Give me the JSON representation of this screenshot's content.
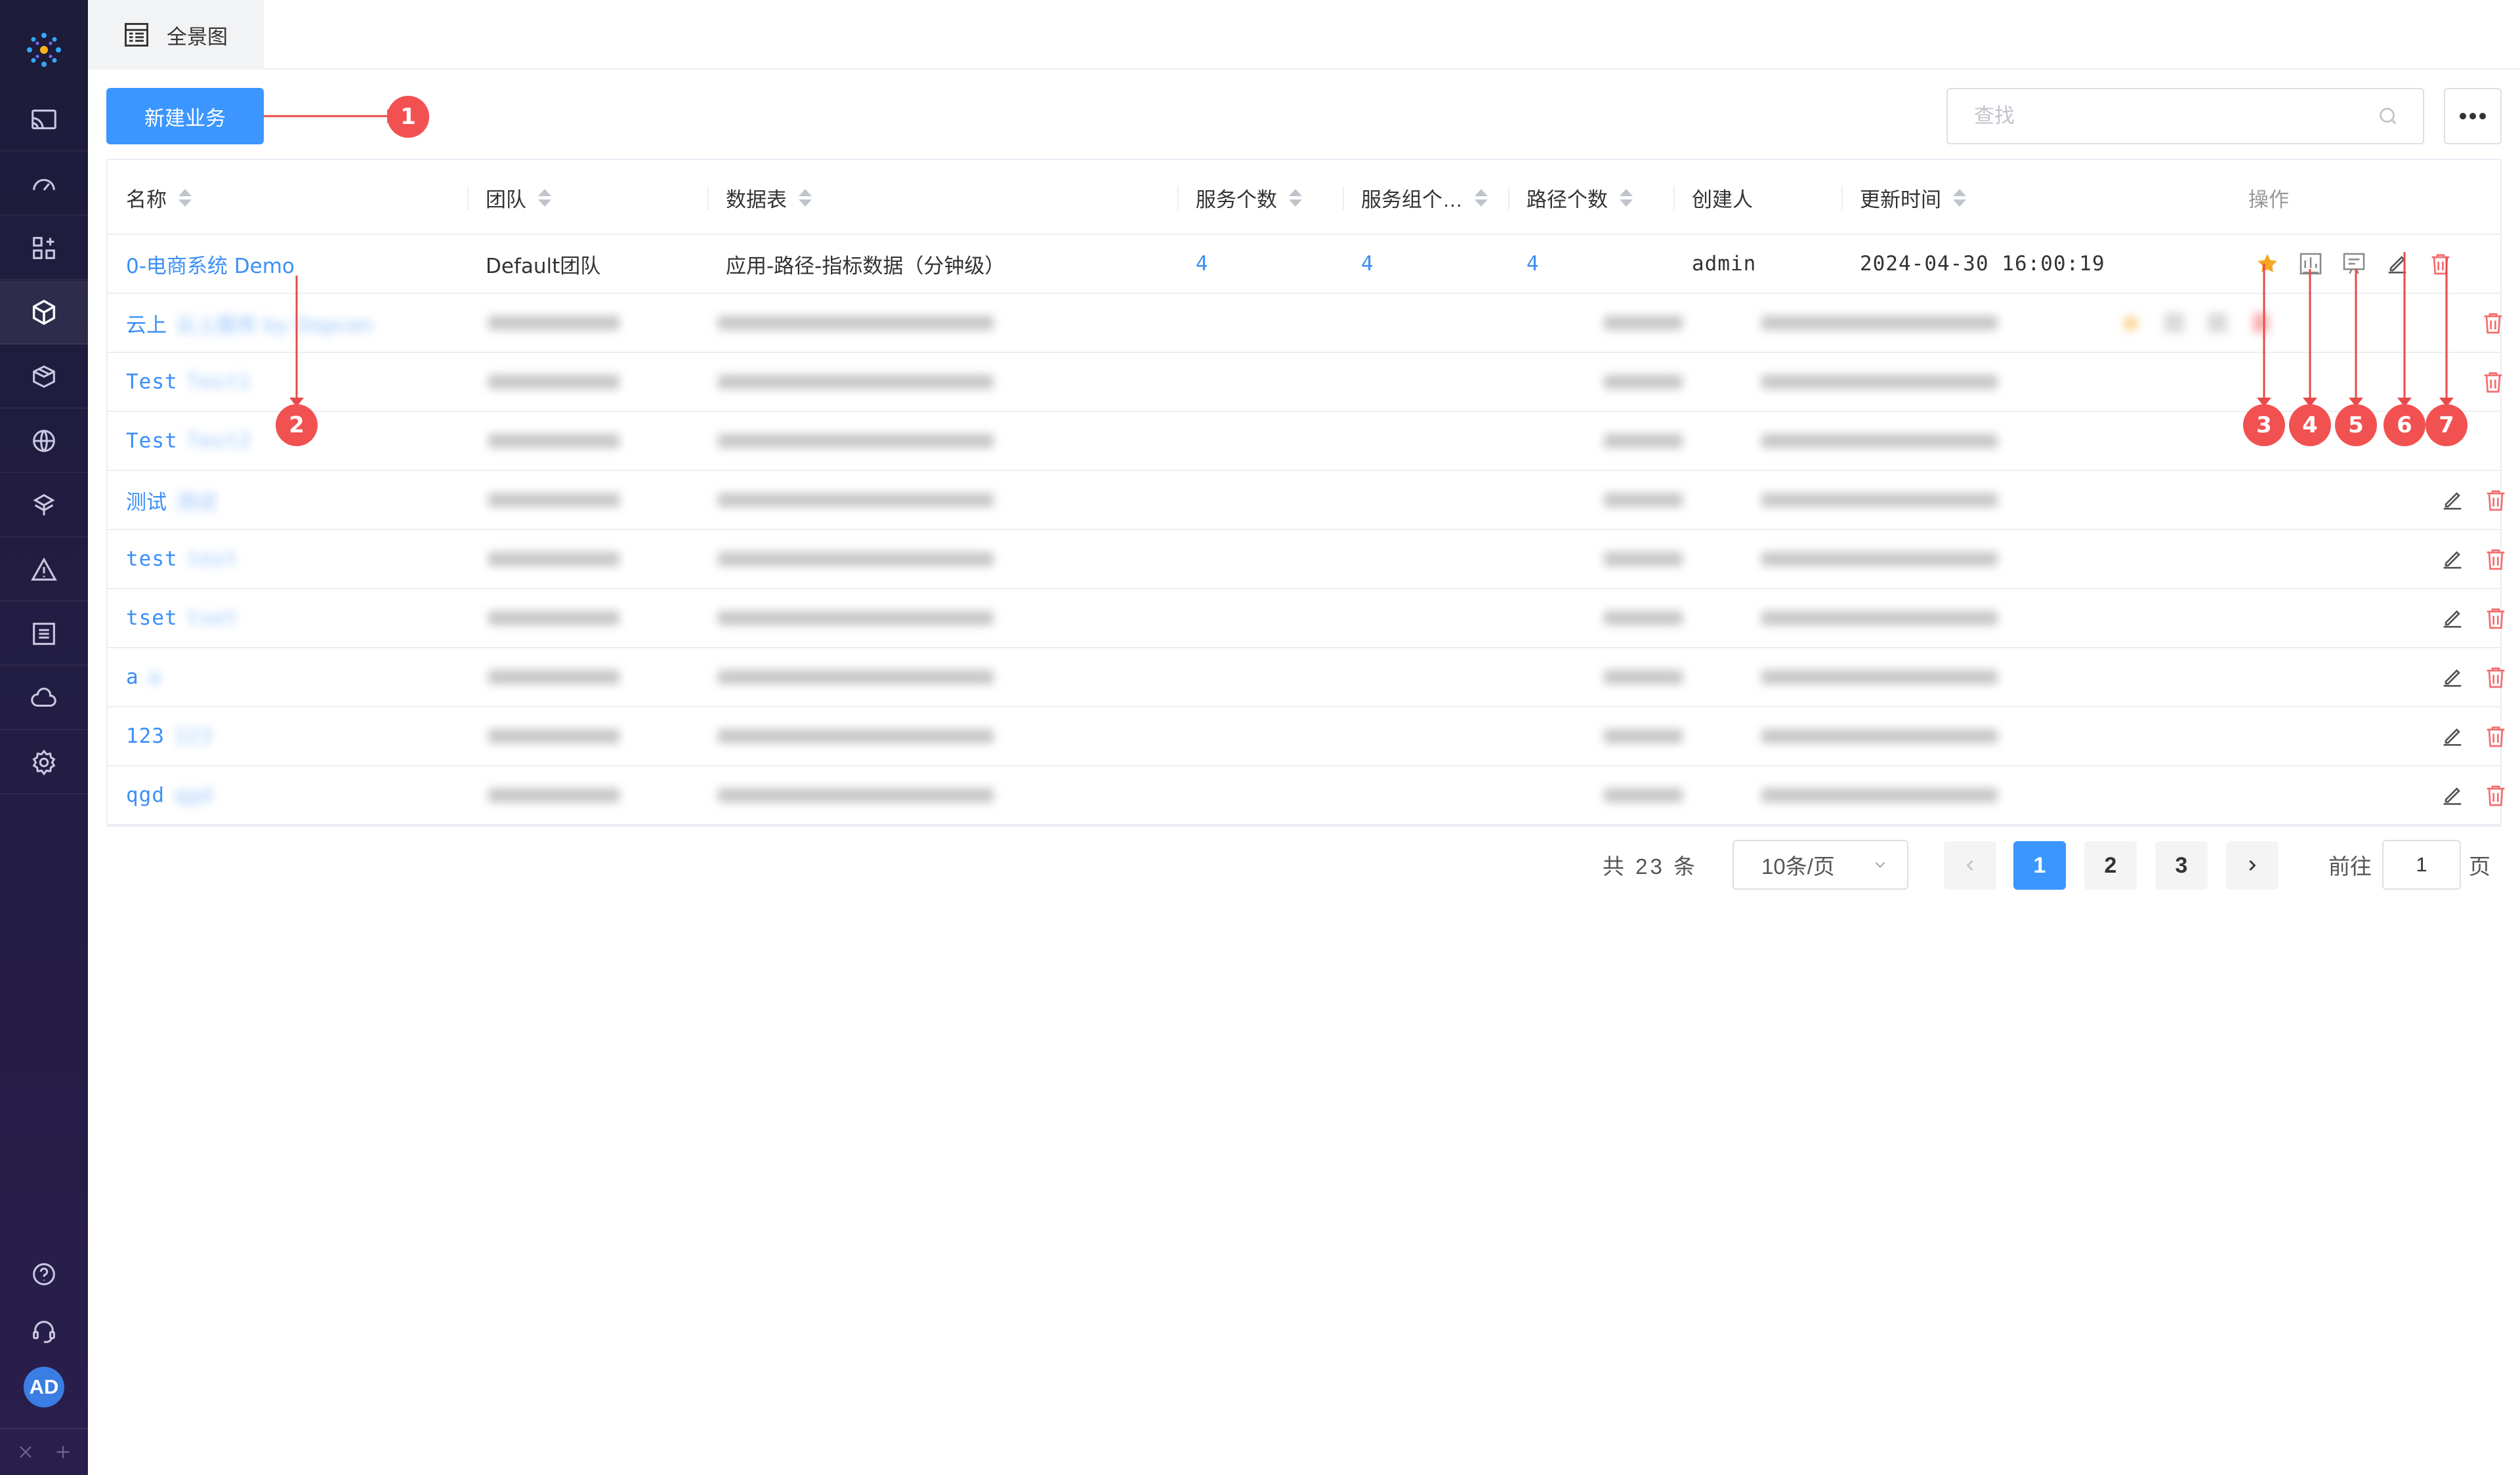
{
  "tab": {
    "label": "全景图"
  },
  "toolbar": {
    "new_button": "新建业务",
    "search_placeholder": "查找"
  },
  "user": {
    "initials": "AD"
  },
  "table": {
    "headers": {
      "name": "名称",
      "team": "团队",
      "datatable": "数据表",
      "service_count": "服务个数",
      "service_group_count": "服务组个…",
      "path_count": "路径个数",
      "creator": "创建人",
      "updated": "更新时间",
      "ops": "操作"
    },
    "rows": [
      {
        "name": "0-电商系统 Demo",
        "team": "Default团队",
        "datatable": "应用-路径-指标数据（分钟级）",
        "service_count": "4",
        "service_group_count": "4",
        "path_count": "4",
        "creator": "admin",
        "updated": "2024-04-30 16:00:19"
      },
      {
        "name": "云上",
        "name_rest": "云上服务 by Dopcen"
      },
      {
        "name": "Test",
        "name_rest": "Test1"
      },
      {
        "name": "Test",
        "name_rest": "Test2"
      },
      {
        "name": "测试",
        "name_rest": "测试"
      },
      {
        "name": "test",
        "name_rest": "test"
      },
      {
        "name": "tset",
        "name_rest": "tset"
      },
      {
        "name": "a",
        "name_rest": "a"
      },
      {
        "name": "123",
        "name_rest": "123"
      },
      {
        "name": "qgd",
        "name_rest": "qgd"
      }
    ]
  },
  "pagination": {
    "total_text": "共 23 条",
    "page_size": "10条/页",
    "pages": [
      "1",
      "2",
      "3"
    ],
    "current_page": 1,
    "goto_label": "前往",
    "goto_value": "1",
    "goto_suffix": "页"
  },
  "annotations": [
    "1",
    "2",
    "3",
    "4",
    "5",
    "6",
    "7"
  ],
  "colors": {
    "primary": "#3b96ff",
    "link": "#3b8ff7",
    "danger": "#f56c6c",
    "star": "#f7a623",
    "annotation": "#f25151",
    "sidebar": "#1f1c3f"
  }
}
